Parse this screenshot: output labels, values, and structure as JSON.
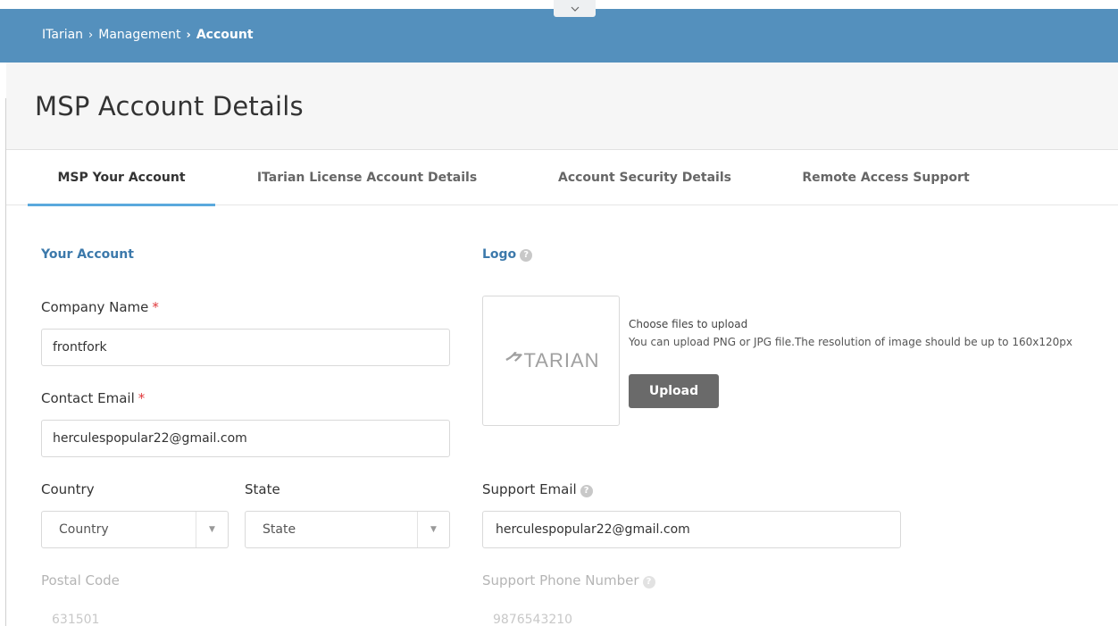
{
  "topbar": {
    "collapse_icon": "chevron-down-icon",
    "breadcrumb": {
      "item1": "ITarian",
      "item2": "Management",
      "current": "Account",
      "separator": "›"
    }
  },
  "header": {
    "title": "MSP Account Details"
  },
  "tabs": [
    {
      "label": "MSP Your Account",
      "active": true
    },
    {
      "label": "ITarian License Account Details",
      "active": false
    },
    {
      "label": "Account Security Details",
      "active": false
    },
    {
      "label": "Remote Access Support",
      "active": false
    }
  ],
  "account": {
    "section_title": "Your Account",
    "company_name": {
      "label": "Company Name",
      "required_mark": "*",
      "value": "frontfork"
    },
    "contact_email": {
      "label": "Contact Email",
      "required_mark": "*",
      "value": "herculespopular22@gmail.com"
    },
    "country": {
      "label": "Country",
      "value": "Country"
    },
    "state": {
      "label": "State",
      "value": "State"
    },
    "postal_code": {
      "label": "Postal Code",
      "value": "631501"
    }
  },
  "logo": {
    "section_title": "Logo",
    "image_text": "TARIAN",
    "choose_text": "Choose files to upload",
    "hint_text": "You can upload PNG or JPG file.The resolution of image should be up to 160x120px",
    "upload_label": "Upload"
  },
  "support": {
    "email": {
      "label": "Support Email",
      "value": "herculespopular22@gmail.com"
    },
    "phone": {
      "label": "Support Phone Number",
      "value": "9876543210"
    }
  },
  "colors": {
    "topbar": "#5490bd",
    "accent_tab": "#5aa9dd",
    "section_title": "#3c79ab",
    "required": "#e0383b",
    "upload_button": "#6a6a6a"
  }
}
